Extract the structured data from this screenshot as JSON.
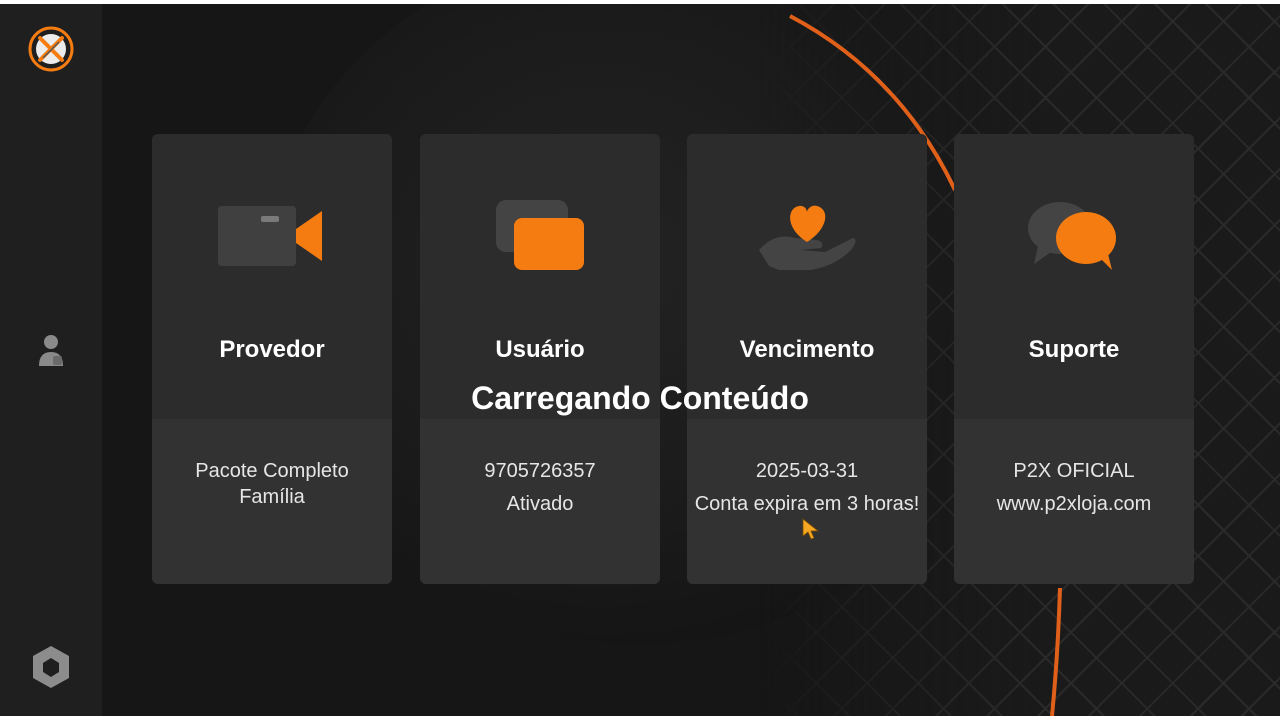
{
  "colors": {
    "accent": "#F57C10",
    "background": "#161616",
    "card": "#2c2c2c",
    "card_lower": "#323232",
    "icon_gray": "#3e3e3e"
  },
  "sidebar": {
    "items": [
      {
        "icon": "logo-x-icon"
      },
      {
        "icon": "user-icon"
      },
      {
        "icon": "hexagon-settings-icon"
      }
    ]
  },
  "cards": [
    {
      "icon": "video-camera-icon",
      "title": "Provedor",
      "lines": [
        "Pacote Completo",
        "Família"
      ]
    },
    {
      "icon": "chat-bubbles-icon",
      "title": "Usuário",
      "lines": [
        "9705726357",
        "Ativado"
      ]
    },
    {
      "icon": "heart-hand-icon",
      "title": "Vencimento",
      "lines": [
        "2025-03-31",
        "Conta expira em 3 horas!"
      ]
    },
    {
      "icon": "support-chat-icon",
      "title": "Suporte",
      "lines": [
        "P2X OFICIAL",
        "www.p2xloja.com"
      ]
    }
  ],
  "loading_text": "Carregando Conteúdo"
}
